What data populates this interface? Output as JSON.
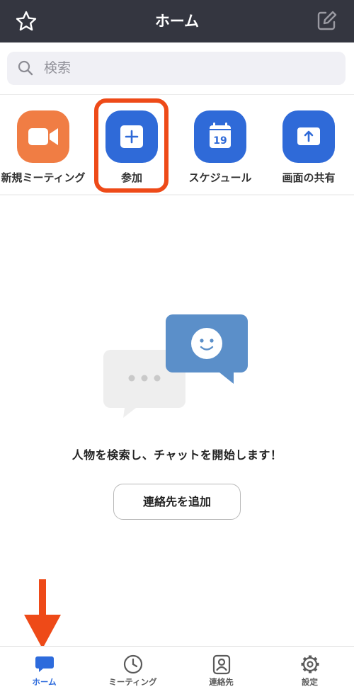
{
  "header": {
    "title": "ホーム",
    "star_icon": "star-icon",
    "edit_icon": "edit-icon"
  },
  "search": {
    "placeholder": "検索"
  },
  "actions": [
    {
      "label": "新規ミーティング",
      "icon": "video-camera-icon",
      "color": "#f07d44"
    },
    {
      "label": "参加",
      "icon": "plus-icon",
      "color": "#2f6ad8",
      "highlighted": true
    },
    {
      "label": "スケジュール",
      "icon": "calendar-icon",
      "color": "#2f6ad8",
      "calendar_day": "19"
    },
    {
      "label": "画面の共有",
      "icon": "share-up-arrow-icon",
      "color": "#2f6ad8"
    }
  ],
  "empty_state": {
    "message": "人物を検索し、チャットを開始します！",
    "add_contact_button": "連絡先を追加"
  },
  "annotation": {
    "color": "#ee4a18"
  },
  "tabbar": {
    "active_color": "#2d6bdc",
    "tabs": [
      {
        "label": "ホーム",
        "icon": "chat-bubble-icon",
        "active": true
      },
      {
        "label": "ミーティング",
        "icon": "clock-icon"
      },
      {
        "label": "連絡先",
        "icon": "contact-icon"
      },
      {
        "label": "設定",
        "icon": "gear-icon"
      }
    ]
  }
}
